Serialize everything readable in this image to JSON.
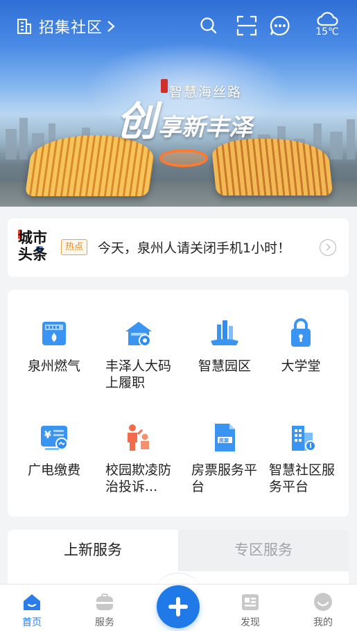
{
  "header": {
    "community_name": "招集社区",
    "weather_temp": "15℃",
    "icons": [
      "building-icon",
      "chevron-right-icon",
      "search-icon",
      "scan-icon",
      "message-icon",
      "cloud-icon"
    ]
  },
  "banner": {
    "slogan_small": "智慧海丝路",
    "slogan_big_1": "创",
    "slogan_big_2": "享新丰泽"
  },
  "news": {
    "logo_line1": "城市",
    "logo_line2": "头条",
    "badge": "热点",
    "headline": "今天，泉州人请关闭手机1小时！"
  },
  "services": [
    {
      "label": "泉州燃气",
      "icon": "gas-meter-icon",
      "color": "#2f8cf0"
    },
    {
      "label": "丰泽人大码上履职",
      "icon": "house-gear-icon",
      "color": "#2f8cf0"
    },
    {
      "label": "智慧园区",
      "icon": "skyline-icon",
      "color": "#2f8cf0"
    },
    {
      "label": "大学堂",
      "icon": "lock-book-icon",
      "color": "#2f8cf0"
    },
    {
      "label": "广电缴费",
      "icon": "tv-payment-icon",
      "color": "#2f8cf0"
    },
    {
      "label": "校园欺凌防治投诉...",
      "icon": "bullying-icon",
      "color": "#f26b4b"
    },
    {
      "label": "房票服务平台",
      "icon": "house-ticket-icon",
      "color": "#2f8cf0"
    },
    {
      "label": "智慧社区服务平台",
      "icon": "smart-community-icon",
      "color": "#2f8cf0"
    }
  ],
  "tabs": [
    {
      "label": "上新服务",
      "active": true
    },
    {
      "label": "专区服务",
      "active": false
    }
  ],
  "bottom_nav": [
    {
      "label": "首页",
      "icon": "home-icon",
      "active": true
    },
    {
      "label": "服务",
      "icon": "briefcase-icon",
      "active": false
    },
    {
      "label": "发现",
      "icon": "news-icon",
      "active": false
    },
    {
      "label": "我的",
      "icon": "profile-icon",
      "active": false
    }
  ],
  "colors": {
    "accent": "#2b7de9",
    "hot_badge": "#f08a1c",
    "background": "#f2f4f6"
  }
}
